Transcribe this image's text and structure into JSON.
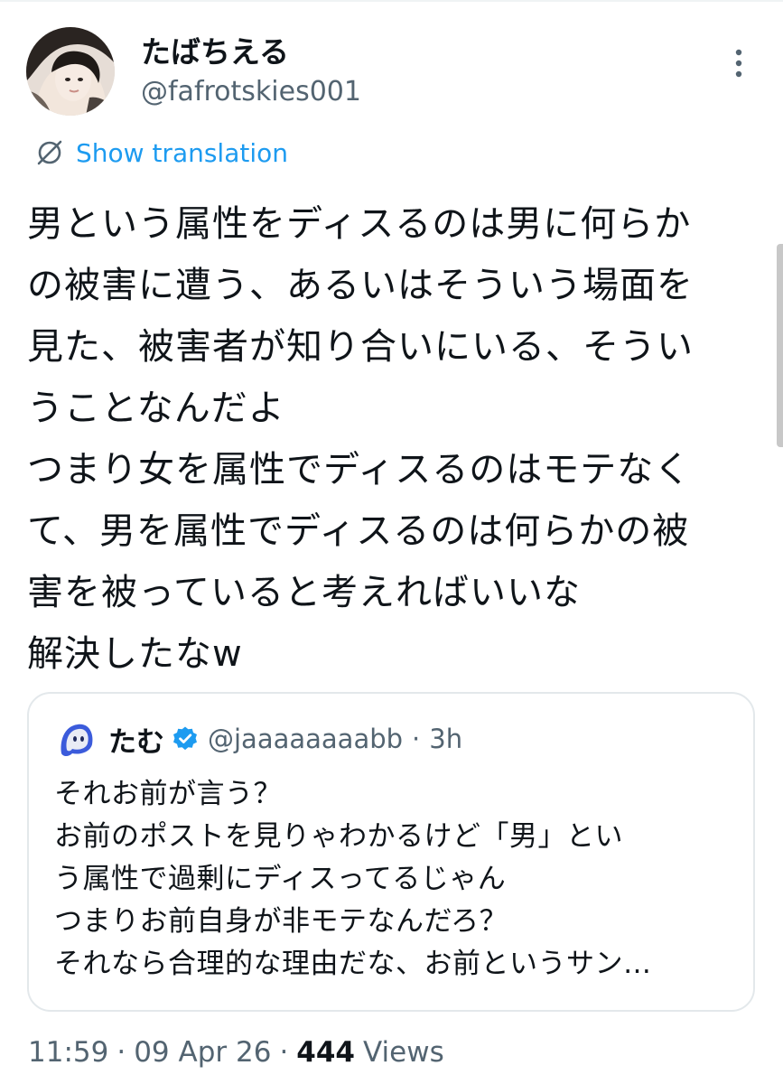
{
  "author": {
    "display_name": "たばちえる",
    "handle": "@fafrotskies001",
    "avatar_icon": "user-avatar-photo"
  },
  "more_icon": "more-vertical-icon",
  "translation": {
    "icon": "translate-icon",
    "label": "Show translation"
  },
  "tweet": {
    "lines": [
      "男という属性をディスるのは男に何らか",
      "の被害に遭う、あるいはそういう場面を",
      "見た、被害者が知り合いにいる、そうい",
      "うことなんだよ",
      "つまり女を属性でディスるのはモテなく",
      "て、男を属性でディスるのは何らかの被",
      "害を被っていると考えればいいな",
      "解決したなw"
    ]
  },
  "quote": {
    "display_name": "たむ",
    "verified_icon": "verified-badge-icon",
    "handle": "@jaaaaaaaabb",
    "separator": "·",
    "time": "3h",
    "avatar_icon": "blue-ghost-avatar",
    "lines": [
      "それお前が言う？",
      "お前のポストを見りゃわかるけど「男」とい",
      "う属性で過剰にディスってるじゃん",
      "つまりお前自身が非モテなんだろ？",
      "それなら合理的な理由だな、お前というサン…"
    ]
  },
  "meta": {
    "time": "11:59",
    "sep1": "·",
    "date": "09 Apr 26",
    "sep2": "·",
    "views_count": "444",
    "views_label": "Views"
  },
  "colors": {
    "text": "#0f1419",
    "secondary": "#536471",
    "link": "#1d9bf0",
    "border": "#e3e8eb"
  }
}
